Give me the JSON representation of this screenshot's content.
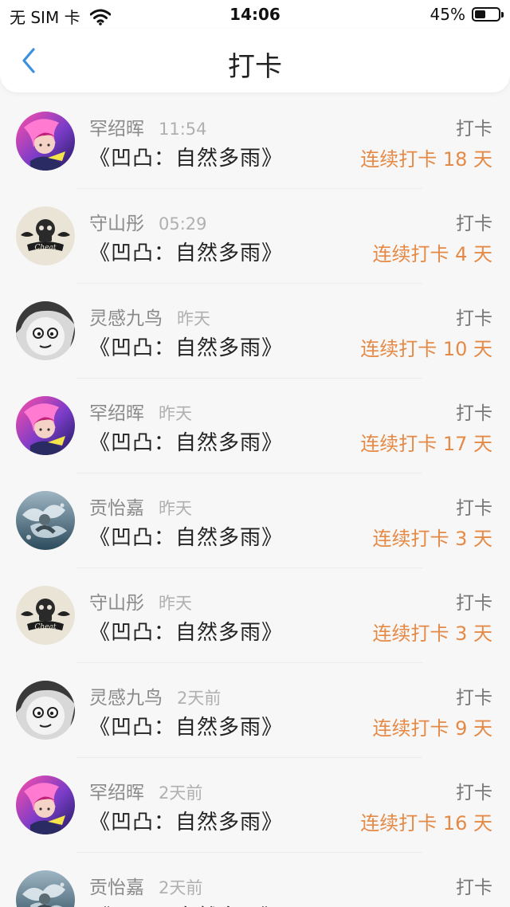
{
  "status_bar": {
    "carrier": "无 SIM 卡",
    "time": "14:06",
    "battery": "45%",
    "battery_level": 0.45,
    "icons": [
      "wifi-icon",
      "battery-icon"
    ]
  },
  "nav": {
    "title": "打卡",
    "back_icon": "chevron-left-icon",
    "accent_color": "#3d8fe0"
  },
  "colors": {
    "streak": "#e58a46",
    "name": "#8a8a8a",
    "time": "#b0b0b0"
  },
  "items": [
    {
      "name": "罕绍晖",
      "time": "11:54",
      "book": "《凹凸：自然多雨》",
      "action": "打卡",
      "streak": "连续打卡 18 天",
      "avatar": "avatar-anime-pink"
    },
    {
      "name": "守山彤",
      "time": "05:29",
      "book": "《凹凸：自然多雨》",
      "action": "打卡",
      "streak": "连续打卡 4 天",
      "avatar": "avatar-skull-logo"
    },
    {
      "name": "灵感九鸟",
      "time": "昨天",
      "book": "《凹凸：自然多雨》",
      "action": "打卡",
      "streak": "连续打卡 10 天",
      "avatar": "avatar-sketch-face"
    },
    {
      "name": "罕绍晖",
      "time": "昨天",
      "book": "《凹凸：自然多雨》",
      "action": "打卡",
      "streak": "连续打卡 17 天",
      "avatar": "avatar-anime-pink"
    },
    {
      "name": "贡怡嘉",
      "time": "昨天",
      "book": "《凹凸：自然多雨》",
      "action": "打卡",
      "streak": "连续打卡 3 天",
      "avatar": "avatar-water-photo"
    },
    {
      "name": "守山彤",
      "time": "昨天",
      "book": "《凹凸：自然多雨》",
      "action": "打卡",
      "streak": "连续打卡 3 天",
      "avatar": "avatar-skull-logo"
    },
    {
      "name": "灵感九鸟",
      "time": "2天前",
      "book": "《凹凸：自然多雨》",
      "action": "打卡",
      "streak": "连续打卡 9 天",
      "avatar": "avatar-sketch-face"
    },
    {
      "name": "罕绍晖",
      "time": "2天前",
      "book": "《凹凸：自然多雨》",
      "action": "打卡",
      "streak": "连续打卡 16 天",
      "avatar": "avatar-anime-pink"
    },
    {
      "name": "贡怡嘉",
      "time": "2天前",
      "book": "《凹凸：自然多雨》",
      "action": "打卡",
      "streak": "",
      "avatar": "avatar-water-photo"
    }
  ]
}
